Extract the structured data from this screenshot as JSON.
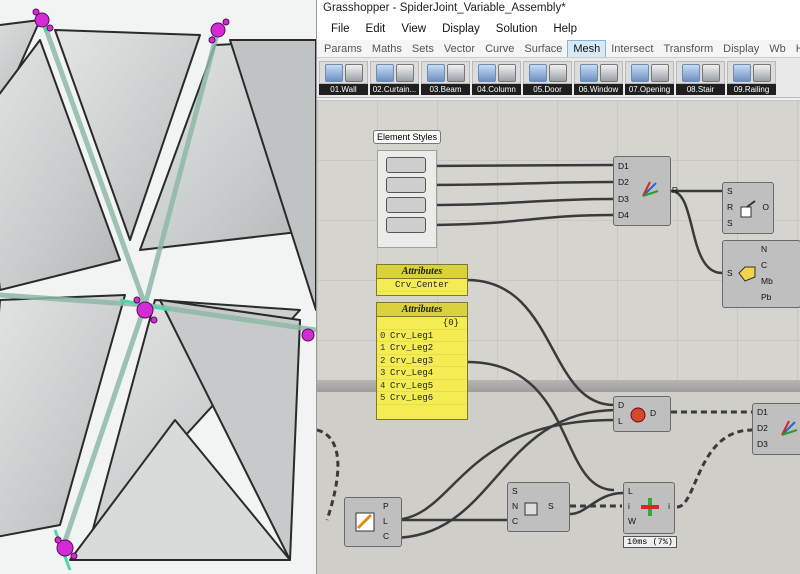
{
  "window": {
    "title": "Grasshopper - SpiderJoint_Variable_Assembly*"
  },
  "menu": [
    "File",
    "Edit",
    "View",
    "Display",
    "Solution",
    "Help"
  ],
  "tabs": [
    "Params",
    "Maths",
    "Sets",
    "Vector",
    "Curve",
    "Surface",
    "Mesh",
    "Intersect",
    "Transform",
    "Display",
    "Wb",
    "Heliotro"
  ],
  "active_tab": "Mesh",
  "toolbar": [
    "01.Wall",
    "02.Curtain...",
    "03.Beam",
    "04.Column",
    "05.Door",
    "06.Window",
    "07.Opening",
    "08.Stair",
    "09.Railing"
  ],
  "canvas": {
    "element_styles": {
      "label": "Element Styles"
    },
    "attributes_single": {
      "title": "Attributes",
      "value": "Crv_Center"
    },
    "attributes_list": {
      "title": "Attributes",
      "header": "{0}",
      "rows": [
        {
          "idx": "0",
          "value": "Crv_Leg1"
        },
        {
          "idx": "1",
          "value": "Crv_Leg2"
        },
        {
          "idx": "2",
          "value": "Crv_Leg3"
        },
        {
          "idx": "3",
          "value": "Crv_Leg4"
        },
        {
          "idx": "4",
          "value": "Crv_Leg5"
        },
        {
          "idx": "5",
          "value": "Crv_Leg6"
        }
      ]
    },
    "merge_top": {
      "inputs": [
        "D1",
        "D2",
        "D3",
        "D4"
      ],
      "output": "R"
    },
    "comp_sro": {
      "inputs": [
        "S",
        "R",
        "S"
      ],
      "output": "O"
    },
    "comp_deconstruct": {
      "input": "S",
      "outputs": [
        "N",
        "C",
        "Mb",
        "Pb"
      ]
    },
    "comp_dl": {
      "inputs": [
        "D",
        "L"
      ],
      "output": "D"
    },
    "merge_bottom": {
      "inputs": [
        "D1",
        "D2",
        "D3"
      ]
    },
    "comp_plc": {
      "outputs": [
        "P",
        "L",
        "C"
      ]
    },
    "comp_snc": {
      "inputs": [
        "S",
        "N",
        "C"
      ],
      "output": "S"
    },
    "comp_liw": {
      "inputs": [
        "L",
        "i",
        "W"
      ],
      "output": "i"
    },
    "timer": "10ms (7%)"
  }
}
